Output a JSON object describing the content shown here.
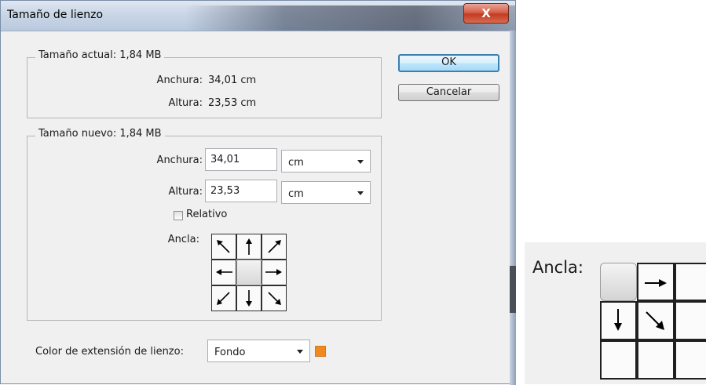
{
  "window": {
    "title": "Tamaño de lienzo",
    "close_glyph": "X"
  },
  "current_size": {
    "legend": "Tamaño actual: 1,84 MB",
    "width_label": "Anchura:",
    "width_value": "34,01 cm",
    "height_label": "Altura:",
    "height_value": "23,53 cm"
  },
  "new_size": {
    "legend": "Tamaño nuevo: 1,84 MB",
    "width_label": "Anchura:",
    "width_value": "34,01",
    "width_unit": "cm",
    "height_label": "Altura:",
    "height_value": "23,53",
    "height_unit": "cm",
    "relative_label": "Relativo",
    "relative_checked": false,
    "anchor_label": "Ancla:",
    "anchor_selected": "center"
  },
  "extension": {
    "label": "Color de extensión de lienzo:",
    "value": "Fondo",
    "swatch_color": "#f08a1e"
  },
  "buttons": {
    "ok": "OK",
    "cancel": "Cancelar"
  },
  "zoom_inset": {
    "anchor_label": "Ancla:",
    "anchor_selected": "top-left"
  },
  "icons": [
    "close-icon",
    "arrow-nw-icon",
    "arrow-n-icon",
    "arrow-ne-icon",
    "arrow-w-icon",
    "arrow-e-icon",
    "arrow-sw-icon",
    "arrow-s-icon",
    "arrow-se-icon",
    "chevron-down-icon"
  ]
}
